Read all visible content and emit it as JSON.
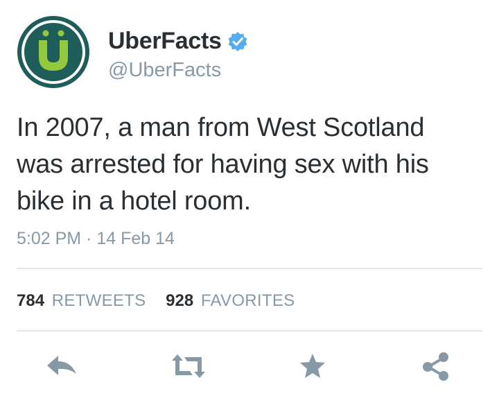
{
  "user": {
    "display_name": "UberFacts",
    "handle": "@UberFacts",
    "verified": true,
    "avatar_letter": "Ü"
  },
  "tweet": {
    "text": "In 2007, a man from West Scotland was arrested for having sex with his bike in a hotel room.",
    "timestamp": "5:02 PM · 14 Feb 14"
  },
  "stats": {
    "retweets_count": "784",
    "retweets_label": "RETWEETS",
    "favorites_count": "928",
    "favorites_label": "FAVORITES"
  },
  "actions": {
    "icons": [
      "reply-icon",
      "retweet-icon",
      "favorite-icon",
      "share-icon"
    ]
  },
  "colors": {
    "avatar_ring": "#1f5d5a",
    "avatar_letter": "#95c93d",
    "verified_badge": "#55acee",
    "muted_text": "#8899a6",
    "action_icon": "#8899a6"
  }
}
